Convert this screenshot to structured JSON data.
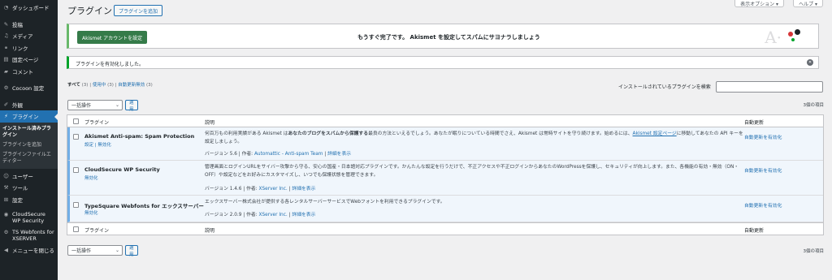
{
  "sidebar": {
    "items": [
      {
        "label": "ダッシュボード",
        "icon": "dashboard-icon",
        "glyph": "◔"
      },
      {
        "label": "投稿",
        "icon": "pin-icon",
        "glyph": "✎"
      },
      {
        "label": "メディア",
        "icon": "media-icon",
        "glyph": "♫"
      },
      {
        "label": "リンク",
        "icon": "link-icon",
        "glyph": "⚭"
      },
      {
        "label": "固定ページ",
        "icon": "page-icon",
        "glyph": "▤"
      },
      {
        "label": "コメント",
        "icon": "comment-icon",
        "glyph": "▰"
      },
      {
        "label": "Cocoon 設定",
        "icon": "cocoon-icon",
        "glyph": "⚙"
      },
      {
        "label": "外観",
        "icon": "appearance-icon",
        "glyph": "✐"
      },
      {
        "label": "プラグイン",
        "icon": "plugin-icon",
        "glyph": "⚡"
      }
    ],
    "submenu": [
      "インストール済みプラグイン",
      "プラグインを追加",
      "プラグインファイルエディター"
    ],
    "items2": [
      {
        "label": "ユーザー",
        "icon": "user-icon",
        "glyph": "☺"
      },
      {
        "label": "ツール",
        "icon": "tools-icon",
        "glyph": "⚒"
      },
      {
        "label": "設定",
        "icon": "settings-icon",
        "glyph": "⊞"
      },
      {
        "label": "CloudSecure WP Security",
        "icon": "cloudsecure-icon",
        "glyph": "◉"
      },
      {
        "label": "TS Webfonts for XSERVER",
        "icon": "ts-icon",
        "glyph": "⚙"
      },
      {
        "label": "メニューを閉じる",
        "icon": "collapse-icon",
        "glyph": "◀"
      }
    ]
  },
  "header": {
    "title": "プラグイン",
    "add_button": "プラグインを追加",
    "screen_options": "表示オプション ▾",
    "help": "ヘルプ ▾"
  },
  "akismet": {
    "button": "Akismet アカウントを設定",
    "message": "もうすぐ完了です。 Akismet を設定してスパムにサヨナラしましょう",
    "logo": "A·"
  },
  "notice": {
    "text": "プラグインを有効化しました。",
    "dismiss": "✕"
  },
  "filters": {
    "all": "すべて",
    "all_count": "(3)",
    "active": "使用中",
    "active_count": "(3)",
    "auto_disabled": "自動更新無効",
    "auto_disabled_count": "(3)",
    "sep": "|"
  },
  "search": {
    "label": "インストールされているプラグインを検索"
  },
  "bulk": {
    "select": "一括操作",
    "apply": "適用",
    "count": "3個の項目"
  },
  "columns": {
    "plugin": "プラグイン",
    "description": "説明",
    "auto_update": "自動更新"
  },
  "plugins": [
    {
      "name": "Akismet Anti-spam: Spam Protection",
      "actions": "設定 | 無効化",
      "desc_pre": "何百万もの利用実績がある Akismet は",
      "desc_bold": "あなたのブログをスパムから保護する",
      "desc_mid": "最良の方法といえるでしょう。あなたが眠りについている時間でさえ、Akismet は常時サイトを守り続けます。始めるには、",
      "desc_link": "Akismet 設定ページ",
      "desc_post": "に移動してあなたの API キーを設定しましょう。",
      "version": "バージョン 5.6 | 作者: ",
      "author": "Automattic - Anti-spam Team",
      "sep": " | ",
      "details": "詳細を表示",
      "auto_update": "自動更新を有効化"
    },
    {
      "name": "CloudSecure WP Security",
      "actions": "無効化",
      "desc": "管理画面とログインURLをサイバー攻撃から守る、安心の国産・日本語対応プラグインです。かんたんな設定を行うだけで、不正アクセスや不正ログインからあなたのWordPressを保護し、セキュリティが向上します。また、各機能の有効・無効（ON・OFF）や設定などをお好みにカスタマイズし、いつでも保護状態を管理できます。",
      "version": "バージョン 1.4.6 | 作者: ",
      "author": "XServer Inc.",
      "sep": " | ",
      "details": "詳細を表示",
      "auto_update": "自動更新を有効化"
    },
    {
      "name": "TypeSquare Webfonts for エックスサーバー",
      "actions": "無効化",
      "desc": "エックスサーバー株式会社が提供する各レンタルサーバーサービスでWebフォントを利用できるプラグインです。",
      "version": "バージョン 2.0.9 | 作者: ",
      "author": "XServer Inc.",
      "sep": " | ",
      "details": "詳細を表示",
      "auto_update": "自動更新を有効化"
    }
  ],
  "colors": {
    "sidebar_bg": "#1d2327",
    "accent": "#2271b1",
    "akismet_green": "#357b49",
    "active_row": "#f0f6fc"
  }
}
